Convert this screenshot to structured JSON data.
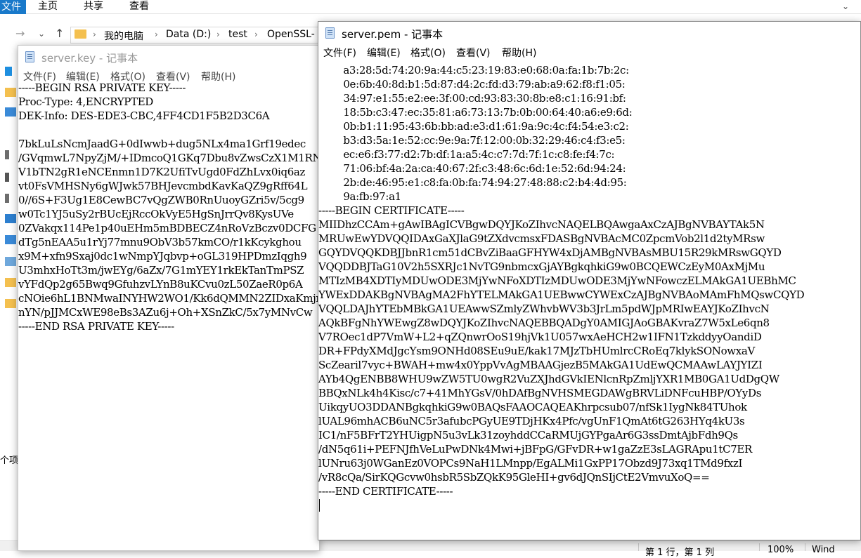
{
  "explorer": {
    "ribbon": {
      "file": "文件",
      "tabs": [
        "主页",
        "共享",
        "查看"
      ]
    },
    "breadcrumb": [
      "我的电脑",
      "Data (D:)",
      "test",
      "OpenSSL-"
    ],
    "side_label": "个项",
    "status": {
      "position": "第 1 行，第 1 列",
      "zoom": "100%",
      "encoding": "Wind"
    }
  },
  "key_window": {
    "title": "server.key - 记事本",
    "menu": [
      "文件(F)",
      "编辑(E)",
      "格式(O)",
      "查看(V)",
      "帮助(H)"
    ],
    "lines": [
      "-----BEGIN RSA PRIVATE KEY-----",
      "Proc-Type: 4,ENCRYPTED",
      "DEK-Info: DES-EDE3-CBC,4FF4CD1F5B2D3C6A",
      "",
      "7bkLuLsNcmJaadG+0dIwwb+dug5NLx4ma1Grf19edec",
      "/GVqmwL7NpyZjM/+IDmcoQ1GKq7Dbu8vZwsCzX1M1RN",
      "V1bTN2gR1eNCEnmn1D7K2UfiTvUgd0FdZhLvx0iq6az",
      "vt0FsVMHSNy6gWJwk57BHJevcmbdKavKaQZ9gRff64L",
      "0//6S+F3Ug1E8CewBC7vQgZWB0RnUuoyGZri5v/5cg9",
      "w0Tc1YJ5uSy2rBUcEjRccOkVyE5HgSnJrrQv8KysUVe",
      "0ZVakqx114Pe1p40uEHm5mBDBECZ4nRoVzBczv0DCFG",
      "dTg5nEAA5u1rYj77mnu9ObV3b57kmCO/r1kKcykghou",
      "x9M+xfn9Sxaj0dc1wNmpYJqbvp+oGL319HPDmzIqgh9",
      "U3mhxHoTt3m/jwEYg/6aZx/7G1mYEY1rkEkTanTmPSZ",
      "vYFdQp2g65Bwq9GfuhzvLYnB8uKCvu0zL50ZaeR0p6A",
      "cNOie6hL1BNMwaINYHW2WO1/Kk6dQMMN2ZIDxaKmjrX",
      "nYN/pJJMCxWE98eBs3AZu6j+Oh+XSnZkC/5x7yMNvCw",
      "-----END RSA PRIVATE KEY-----"
    ]
  },
  "pem_window": {
    "title": "server.pem - 记事本",
    "menu": [
      "文件(F)",
      "编辑(E)",
      "格式(O)",
      "查看(V)",
      "帮助(H)"
    ],
    "lines": [
      "        a3:28:5d:74:20:9a:44:c5:23:19:83:e0:68:0a:fa:1b:7b:2c:",
      "        0e:6b:40:8d:b1:5d:87:d4:2c:fd:d3:79:ab:a9:62:f8:f1:05:",
      "        34:97:e1:55:e2:ee:3f:00:cd:93:83:30:8b:e8:c1:16:91:bf:",
      "        18:5b:c3:47:ec:35:81:a6:73:13:7b:0b:00:64:40:a6:e9:6d:",
      "        0b:b1:11:95:43:6b:bb:ad:e3:d1:61:9a:9c:4c:f4:54:e3:c2:",
      "        b3:d3:5a:1e:52:cc:9e:9a:7f:12:00:0b:32:29:46:c4:f3:e5:",
      "        ec:e6:f3:77:d2:7b:df:1a:a5:4c:c7:7d:7f:1c:c8:fe:f4:7c:",
      "        71:06:bf:4a:2a:ca:40:67:2f:c3:48:6c:6d:1e:52:6d:94:24:",
      "        2b:de:46:95:e1:c8:fa:0b:fa:74:94:27:48:88:c2:b4:4d:95:",
      "        9a:fb:97:a1",
      "-----BEGIN CERTIFICATE-----",
      "MIIDhzCCAm+gAwIBAgICVBgwDQYJKoZIhvcNAQELBQAwgaAxCzAJBgNVBAYTAk5N",
      "MRUwEwYDVQQIDAxGaXJlaG9tZXdvcmsxFDASBgNVBAcMC0ZpcmVob2l1d2tyMRsw",
      "GQYDVQQKDBJJbnR1cm51dCBvZiBaaGFHYW4xDjAMBgNVBAsMBU15R29kMRswGQYD",
      "VQQDDBJTaG10V2h5SXRJc1NvTG9nbmcxGjAYBgkqhkiG9w0BCQEWCzEyM0AxMjMu",
      "MTIzMB4XDTIyMDUwODE3MjYwNFoXDTIzMDUwODE3MjYwNFowczELMAkGA1UEBhMC",
      "YWExDDAKBgNVBAgMA2FhYTELMAkGA1UEBwwCYWExCzAJBgNVBAoMAmFhMQswCQYD",
      "VQQLDAJhYTEbMBkGA1UEAwwSZmlyZWhvbWV3b3JrLm5pdWJpMRIwEAYJKoZIhvcN",
      "AQkBFgNhYWEwgZ8wDQYJKoZIhvcNAQEBBQADgY0AMIGJAoGBAKvraZ7W5xLe6qn8",
      "V7ROec1dP7VmW+L2+qZQnwrOoS19hjVk1U057wxAeHCH2w1IFN1TzkddyyOandiD",
      "DR+FPdyXMdJgcYsm9ONHd08SEu9uE/kak17MJzTbHUmlrcCRoEq7klykSONowxaV",
      "ScZearil7vyc+BWAH+mw4x0YppVvAgMBAAGjezB5MAkGA1UdEwQCMAAwLAYJYIZI",
      "AYb4QgENBB8WHU9wZW5TU0wgR2VuZXJhdGVkIENlcnRpZmljYXR1MB0GA1UdDgQW",
      "BBQxNLk4h4Kisc/c7+41MhYGsV/0hDAfBgNVHSMEGDAWgBRVLiDNFcuHBP/OYyDs",
      "UikqyUO3DDANBgkqhkiG9w0BAQsFAAOCAQEAKhrpcsub07/nfSk1IygNk84TUhok",
      "lUAL96mhACB6uNC5r3afubcPGyUE9TDjHKx4Pfc/vgUnF1QmAt6tG263HYq4kU3s",
      "IC1/nF5BFrT2YHUigpN5u3vLk31zoyhddCCaRMUjGYPgaAr6G3ssDmtAjbFdh9Qs",
      "/dN5q61i+PEFNJfhVeLuPwDNk4Mwi+jBFpG/GFvDR+w1gaZzE3sLAGRApu1tC7ER",
      "lUNru63j0WGanEz0VOPCs9NaH1LMnpp/EgALMi1GxPP17Obzd9J73xq1TMd9fxzI",
      "/vR8cQa/SirKQGcvw0hsbR5SbZQkK95GleHI+gv6dJQnSIjCtE2VmvuXoQ==",
      "-----END CERTIFICATE-----"
    ]
  }
}
